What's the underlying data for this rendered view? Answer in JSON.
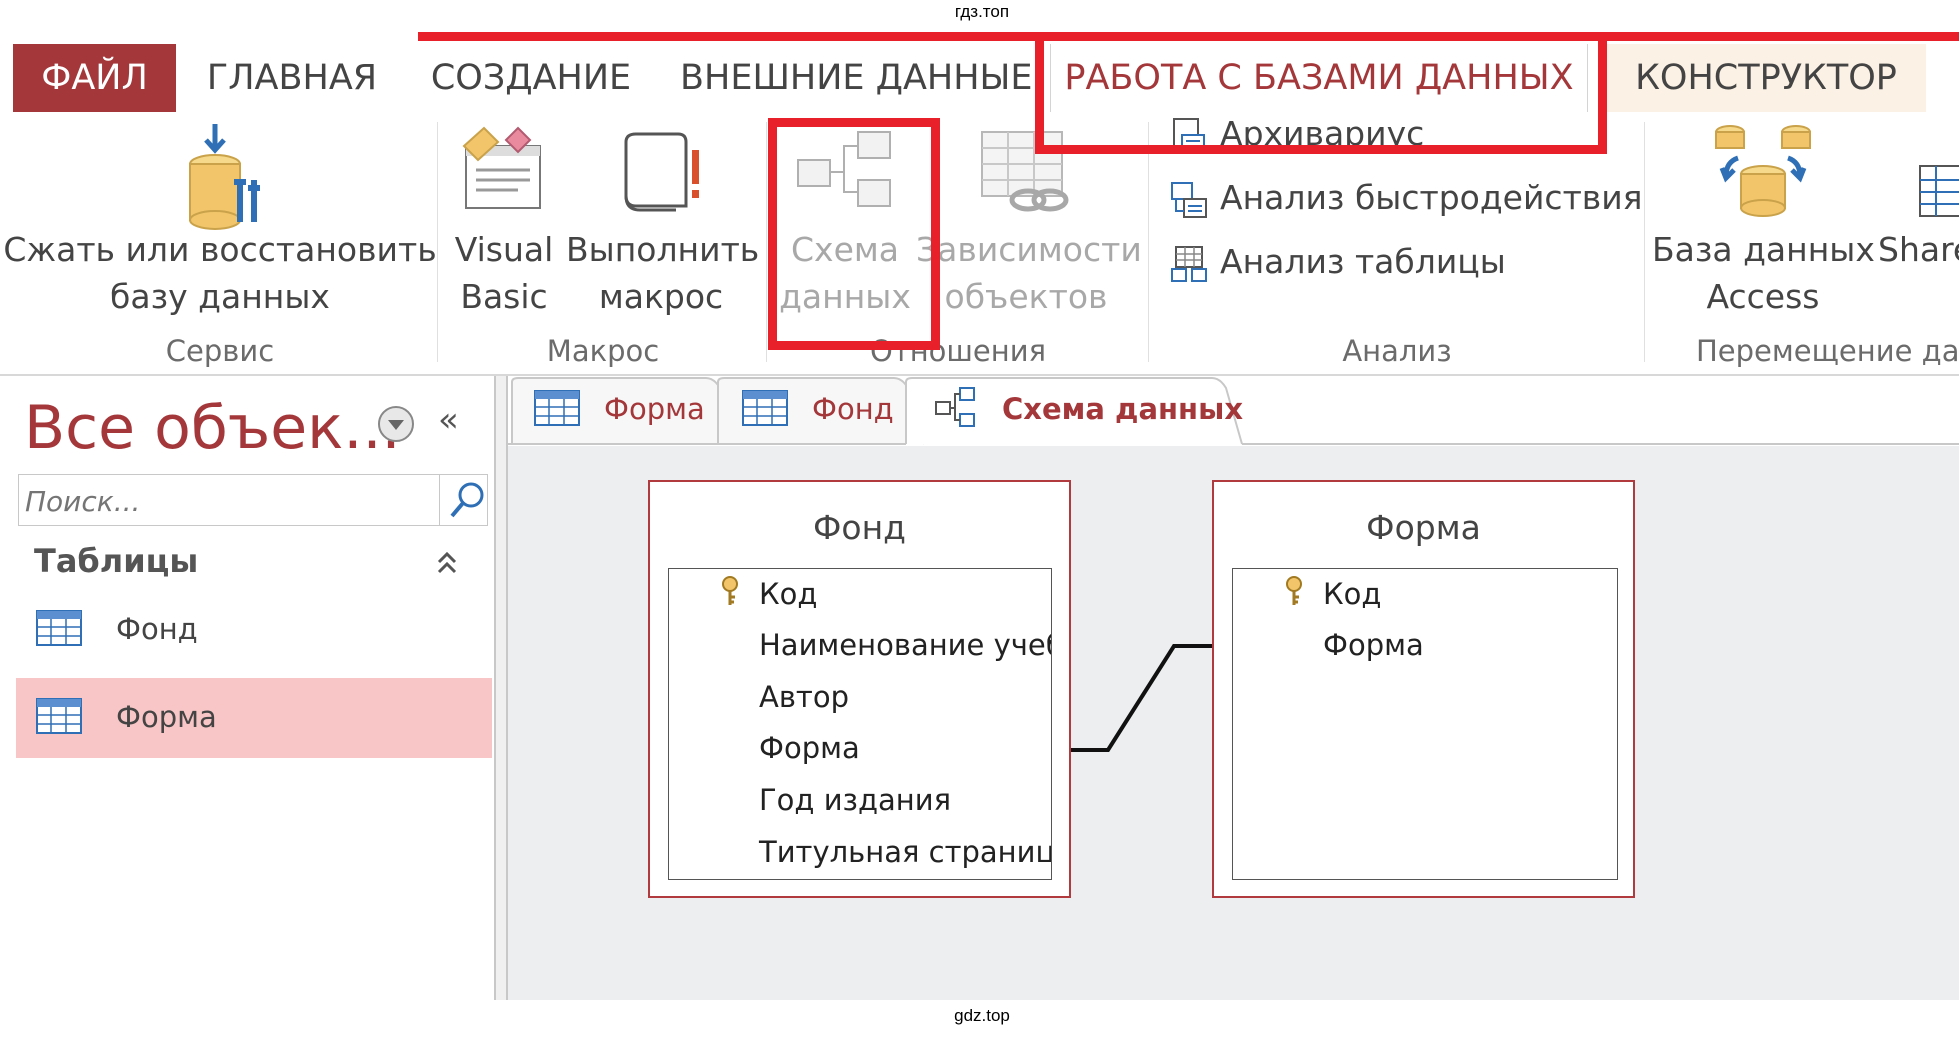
{
  "watermark_top": "гдз.топ",
  "watermark_bottom": "gdz.top",
  "ribbon_tabs": [
    "ФАЙЛ",
    "ГЛАВНАЯ",
    "СОЗДАНИЕ",
    "ВНЕШНИЕ ДАННЫЕ",
    "РАБОТА С БАЗАМИ ДАННЫХ",
    "КОНСТРУКТОР"
  ],
  "ribbon": {
    "compact": {
      "line1": "Сжать или восстановить",
      "line2": "базу данных"
    },
    "group_service": "Сервис",
    "visual_basic": {
      "line1": "Visual",
      "line2": "Basic"
    },
    "run_macro": {
      "line1": "Выполнить",
      "line2": "макрос"
    },
    "group_macro": "Макрос",
    "schema": {
      "line1": "Схема",
      "line2": "данных"
    },
    "dependencies": {
      "line1": "Зависимости",
      "line2": "объектов"
    },
    "group_relations": "Отношения",
    "archivist": "Архивариус",
    "perf_analysis": "Анализ быстродействия",
    "table_analysis": "Анализ таблицы",
    "group_analysis": "Анализ",
    "access_db": {
      "line1": "База данных",
      "line2": "Access"
    },
    "share": "Share",
    "group_move": "Перемещение дан"
  },
  "nav": {
    "title": "Все объек...",
    "search_placeholder": "Поиск...",
    "section": "Таблицы",
    "items": [
      "Фонд",
      "Форма"
    ]
  },
  "doc_tabs": [
    "Форма",
    "Фонд",
    "Схема данных"
  ],
  "tables": [
    {
      "name": "Фонд",
      "fields": [
        "Код",
        "Наименование учеб",
        "Автор",
        "Форма",
        "Год издания",
        "Титульная страница"
      ]
    },
    {
      "name": "Форма",
      "fields": [
        "Код",
        "Форма"
      ]
    }
  ],
  "colors": {
    "accent": "#a4373a",
    "highlight": "#e8202a",
    "selected": "#f9c6c7",
    "canvas": "#eceef0"
  }
}
